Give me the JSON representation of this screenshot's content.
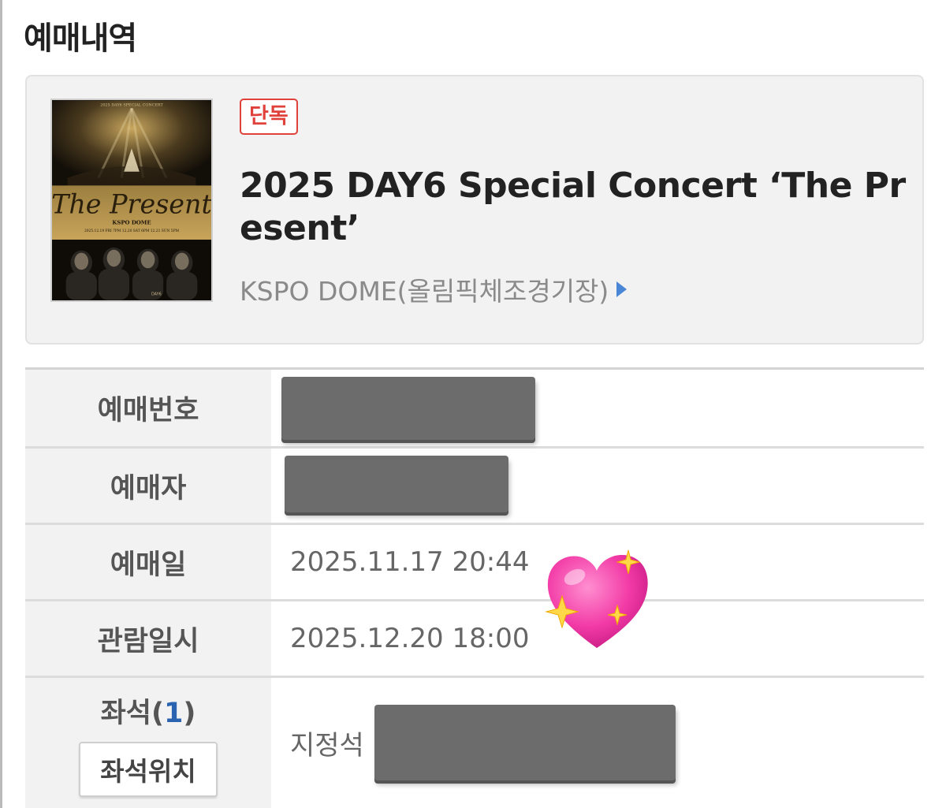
{
  "page": {
    "title": "예매내역"
  },
  "event": {
    "badge": "단독",
    "title": "2025 DAY6 Special Concert ‘The Present’",
    "venue": "KSPO DOME(올림픽체조경기장)",
    "poster": {
      "header_text": "2025 DAY6 SPECIAL CONCERT",
      "script_title": "The Present",
      "venue_text": "KSPO DOME",
      "dates_text": "2025.12.19 FRI 7PM   12.20 SAT 6PM   12.21 SUN 5PM",
      "logo_text": "DAY6"
    }
  },
  "details": {
    "booking_number": {
      "label": "예매번호"
    },
    "booker": {
      "label": "예매자"
    },
    "booking_date": {
      "label": "예매일",
      "value": "2025.11.17 20:44"
    },
    "show_datetime": {
      "label": "관람일시",
      "value": "2025.12.20 18:00"
    },
    "seats": {
      "label": "좌석",
      "count": "1",
      "open_paren": "(",
      "close_paren": ")",
      "button_label": "좌석위치",
      "seat_type": "지정석"
    }
  },
  "colors": {
    "badge_red": "#e0413a",
    "venue_arrow_blue": "#4a86d6",
    "seat_count_blue": "#2a63b0",
    "label_bg": "#f2f2f2",
    "redaction_gray": "#6c6c6c"
  },
  "decorations": {
    "sticker": "sparkling-heart-emoji"
  }
}
